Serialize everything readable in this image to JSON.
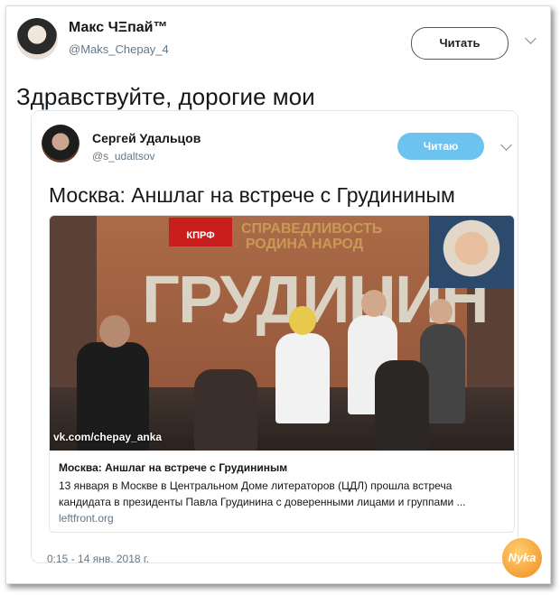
{
  "tweet": {
    "author_name": "Макс ЧΞпай™",
    "author_handle": "@Maks_Chepay_4",
    "follow_label": "Читать",
    "text": "Здравствуйте, дорогие мои",
    "timestamp": "0:15 - 14 янв. 2018 г."
  },
  "quoted": {
    "author_name": "Сергей Удальцов",
    "author_handle": "@s_udaltsov",
    "follow_label": "Читаю",
    "text": "Москва: Аншлаг на встрече с Грудининым",
    "card": {
      "image_text_logo": "КПРФ",
      "image_text_slogan": "СПРАВЕДЛИВОСТЬ РОДИНА НАРОД",
      "image_text_big": "ГРУДИНИН",
      "watermark": "vk.com/chepay_anka",
      "title": "Москва: Аншлаг на встрече с Грудининым",
      "description": "13 января в Москве в Центральном Доме литераторов (ЦДЛ) прошла встреча кандидата в президенты Павла Грудинина с доверенными лицами и группами ...",
      "domain": "leftfront.org"
    }
  },
  "badge": {
    "label": "Nyka"
  },
  "icons": [
    "chevron-down-icon"
  ],
  "colors": {
    "follow_filled": "#6cc3f0",
    "text_primary": "#14171a",
    "text_secondary": "#657786"
  }
}
